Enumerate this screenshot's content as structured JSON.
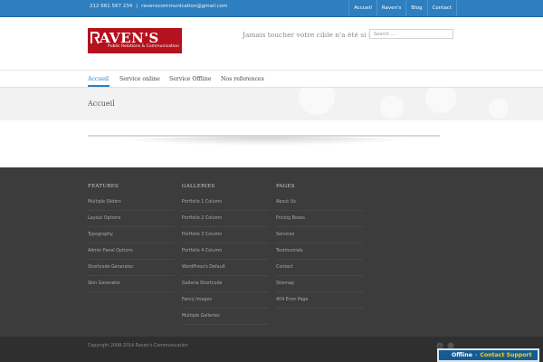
{
  "topbar": {
    "phone": "212 661 567 234",
    "separator": "|",
    "email": "ravenscommunication@gmail.com",
    "nav": [
      "Accueil",
      "Raven's",
      "Blog",
      "Contact"
    ]
  },
  "header": {
    "logo_text": "AVEN'S",
    "logo_subtext": "Public Relations & Communication",
    "tagline": "Jamais toucher votre cible n'a été si facile",
    "search_placeholder": "Search ..."
  },
  "mainnav": [
    "Accueil",
    "Service online",
    "Service Offline",
    "Nos references"
  ],
  "page": {
    "title": "Accueil"
  },
  "footer": {
    "columns": [
      {
        "heading": "FEATURES",
        "items": [
          "Multiple Sliders",
          "Layout Options",
          "Typography",
          "Admin Panel Options",
          "Shortcode Generator",
          "Skin Generator"
        ]
      },
      {
        "heading": "GALLERIES",
        "items": [
          "Portfolio 1 Column",
          "Portfolio 2 Column",
          "Portfolio 3 Column",
          "Portfolio 4 Column",
          "WordPress's Default",
          "Galleria Shortcode",
          "Fancy Images",
          "Multiple Galleries"
        ]
      },
      {
        "heading": "PAGES",
        "items": [
          "About Us",
          "Pricing Boxes",
          "Services",
          "Testimonials",
          "Contact",
          "Sitemap",
          "404 Error Page"
        ]
      }
    ],
    "copyright": "Copyright 2008-2014 Raven's Communication"
  },
  "support": {
    "status": "Offline",
    "dash": "-",
    "label": "Contact Support"
  },
  "colors": {
    "topbar": "#2d7fc0",
    "logo": "#b4121e",
    "footer": "#3c3c3c",
    "accent": "#2d7fc0"
  }
}
